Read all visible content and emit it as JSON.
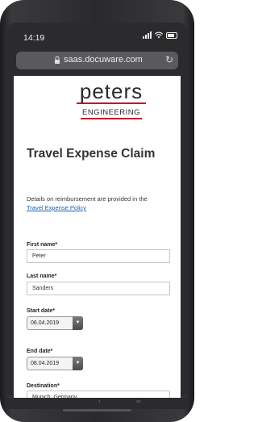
{
  "status": {
    "time": "14:19"
  },
  "browser": {
    "url": "saas.docuware.com",
    "reload_icon": "reload-icon"
  },
  "logo": {
    "name": "peters",
    "sub": "ENGINEERING"
  },
  "form": {
    "title": "Travel Expense Claim",
    "intro": "Details on reimbursement are provided in the",
    "policy_link": "Travel Expense Policy",
    "first_name": {
      "label": "First name*",
      "value": "Peter"
    },
    "last_name": {
      "label": "Last name*",
      "value": "Sanders"
    },
    "start_date": {
      "label": "Start date*",
      "value": "06.04.2019"
    },
    "end_date": {
      "label": "End date*",
      "value": "08.04.2019"
    },
    "destination": {
      "label": "Destination*",
      "value": "Munich, Germany"
    }
  },
  "colors": {
    "brand_red": "#c8102e",
    "link": "#1a5fb4"
  }
}
